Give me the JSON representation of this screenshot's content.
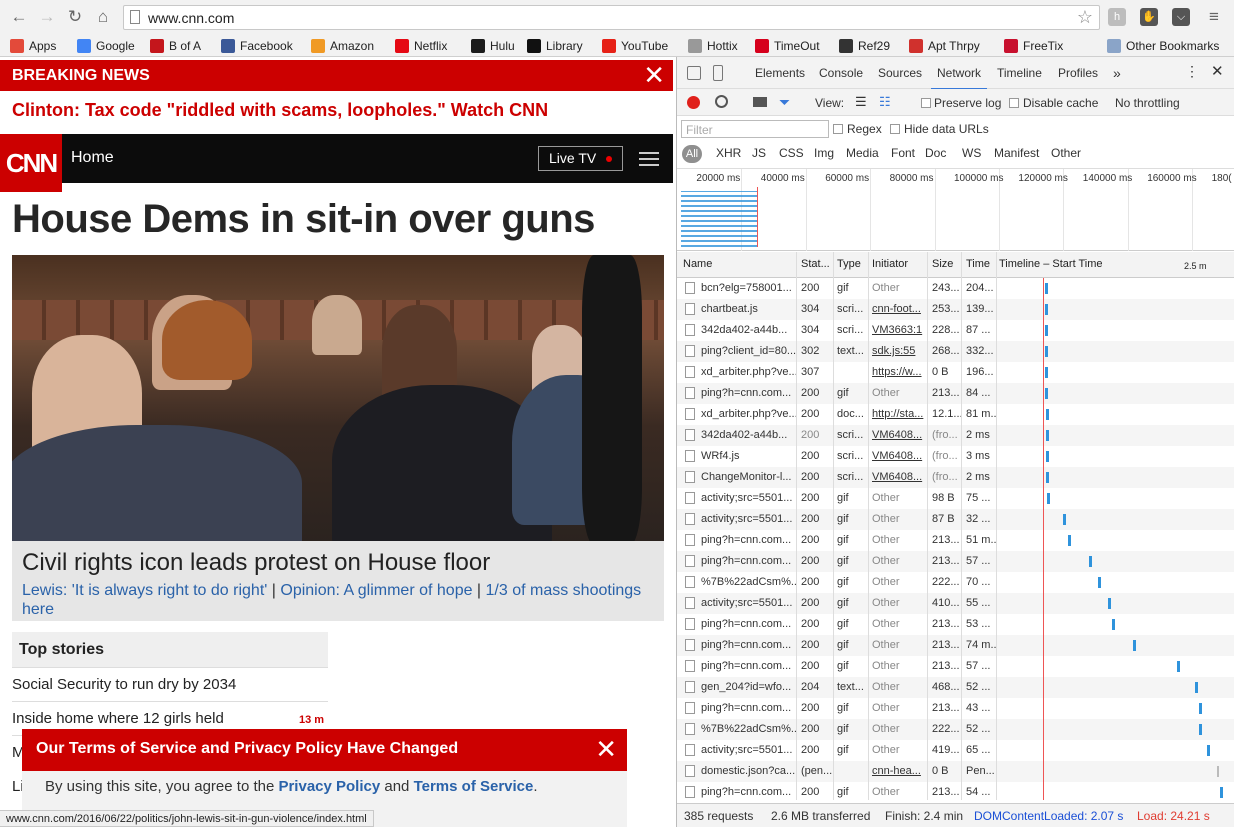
{
  "browser": {
    "url": "www.cnn.com",
    "status_url": "www.cnn.com/2016/06/22/politics/john-lewis-sit-in-gun-violence/index.html"
  },
  "bookmarks": [
    {
      "label": "Apps",
      "icon": "apps-grid-icon",
      "color": "#e34a3a"
    },
    {
      "label": "Google",
      "icon": "google-icon",
      "color": "#4285f4"
    },
    {
      "label": "B of A",
      "icon": "bofa-icon",
      "color": "#c4161c"
    },
    {
      "label": "Facebook",
      "icon": "facebook-icon",
      "color": "#3b5998"
    },
    {
      "label": "Amazon",
      "icon": "amazon-icon",
      "color": "#f09a25"
    },
    {
      "label": "Netflix",
      "icon": "netflix-icon",
      "color": "#e50914"
    },
    {
      "label": "Hulu",
      "icon": "hulu-icon",
      "color": "#1b1b1b"
    },
    {
      "label": "Library",
      "icon": "library-icon",
      "color": "#111111"
    },
    {
      "label": "YouTube",
      "icon": "youtube-icon",
      "color": "#e62117"
    },
    {
      "label": "Hottix",
      "icon": "page-icon",
      "color": "#999999"
    },
    {
      "label": "TimeOut",
      "icon": "timeout-icon",
      "color": "#d6001c"
    },
    {
      "label": "Ref29",
      "icon": "ref29-icon",
      "color": "#333333"
    },
    {
      "label": "Apt Thrpy",
      "icon": "apt-icon",
      "color": "#d0312d"
    },
    {
      "label": "FreeTix",
      "icon": "freetix-icon",
      "color": "#c8102e"
    },
    {
      "label": "Other Bookmarks",
      "icon": "folder-icon",
      "color": "#8aa4c8"
    }
  ],
  "cnn": {
    "breaking_label": "BREAKING NEWS",
    "breaking_link": "Clinton: Tax code \"riddled with scams, loopholes.\" Watch CNN",
    "logo": "CNN",
    "home": "Home",
    "live_tv": "Live TV",
    "headline": "House Dems in sit-in over guns",
    "caption_title": "Civil rights icon leads protest on House floor",
    "caption_links": [
      "Lewis: 'It is always right to do right'",
      "Opinion: A glimmer of hope",
      "1/3 of mass shootings here"
    ],
    "caption_sep": " | ",
    "top_stories_title": "Top stories",
    "stories": [
      "Social Security to run dry by 2034",
      "Inside home where 12 girls held",
      "M",
      "Li"
    ],
    "story_badge": "13 m",
    "terms_title": "Our Terms of Service and Privacy Policy Have Changed",
    "terms_text_1": "By using this site, you agree to the ",
    "terms_link_1": "Privacy Policy",
    "terms_text_2": " and ",
    "terms_link_2": "Terms of Service",
    "terms_text_3": "."
  },
  "devtools": {
    "tabs": [
      "Elements",
      "Console",
      "Sources",
      "Network",
      "Timeline",
      "Profiles"
    ],
    "more": "»",
    "view_label": "View:",
    "preserve_log": "Preserve log",
    "disable_cache": "Disable cache",
    "throttling": "No throttling",
    "filter_placeholder": "Filter",
    "regex": "Regex",
    "hide_data": "Hide data URLs",
    "type_filters": [
      "All",
      "XHR",
      "JS",
      "CSS",
      "Img",
      "Media",
      "Font",
      "Doc",
      "WS",
      "Manifest",
      "Other"
    ],
    "overview_ticks": [
      "20000 ms",
      "40000 ms",
      "60000 ms",
      "80000 ms",
      "100000 ms",
      "120000 ms",
      "140000 ms",
      "160000 ms",
      "180("
    ],
    "columns": [
      "Name",
      "Stat...",
      "Type",
      "Initiator",
      "Size",
      "Time",
      "Timeline – Start Time",
      "2.5 m"
    ],
    "rows": [
      [
        "bcn?elg=758001...",
        "200",
        "gif",
        "Other",
        "243...",
        "204..."
      ],
      [
        "chartbeat.js",
        "304",
        "scri...",
        "cnn-foot...",
        "253...",
        "139..."
      ],
      [
        "342da402-a44b...",
        "304",
        "scri...",
        "VM3663:1",
        "228...",
        "87 ..."
      ],
      [
        "ping?client_id=80...",
        "302",
        "text...",
        "sdk.js:55",
        "268...",
        "332..."
      ],
      [
        "xd_arbiter.php?ve...",
        "307",
        "",
        "https://w...",
        "0 B",
        "196..."
      ],
      [
        "ping?h=cnn.com...",
        "200",
        "gif",
        "Other",
        "213...",
        "84 ..."
      ],
      [
        "xd_arbiter.php?ve...",
        "200",
        "doc...",
        "http://sta...",
        "12.1...",
        "81 m..."
      ],
      [
        "342da402-a44b...",
        "200",
        "scri...",
        "VM6408...",
        "(fro...",
        "2 ms"
      ],
      [
        "WRf4.js",
        "200",
        "scri...",
        "VM6408...",
        "(fro...",
        "3 ms"
      ],
      [
        "ChangeMonitor-l...",
        "200",
        "scri...",
        "VM6408...",
        "(fro...",
        "2 ms"
      ],
      [
        "activity;src=5501...",
        "200",
        "gif",
        "Other",
        "98 B",
        "75 ..."
      ],
      [
        "activity;src=5501...",
        "200",
        "gif",
        "Other",
        "87 B",
        "32 ..."
      ],
      [
        "ping?h=cnn.com...",
        "200",
        "gif",
        "Other",
        "213...",
        "51 m..."
      ],
      [
        "ping?h=cnn.com...",
        "200",
        "gif",
        "Other",
        "213...",
        "57 ..."
      ],
      [
        "%7B%22adCsm%...",
        "200",
        "gif",
        "Other",
        "222...",
        "70 ..."
      ],
      [
        "activity;src=5501...",
        "200",
        "gif",
        "Other",
        "410...",
        "55 ..."
      ],
      [
        "ping?h=cnn.com...",
        "200",
        "gif",
        "Other",
        "213...",
        "53 ..."
      ],
      [
        "ping?h=cnn.com...",
        "200",
        "gif",
        "Other",
        "213...",
        "74 m..."
      ],
      [
        "ping?h=cnn.com...",
        "200",
        "gif",
        "Other",
        "213...",
        "57 ..."
      ],
      [
        "gen_204?id=wfo...",
        "204",
        "text...",
        "Other",
        "468...",
        "52 ..."
      ],
      [
        "ping?h=cnn.com...",
        "200",
        "gif",
        "Other",
        "213...",
        "43 ..."
      ],
      [
        "%7B%22adCsm%...",
        "200",
        "gif",
        "Other",
        "222...",
        "52 ..."
      ],
      [
        "activity;src=5501...",
        "200",
        "gif",
        "Other",
        "419...",
        "65 ..."
      ],
      [
        "domestic.json?ca...",
        "(pen...",
        "",
        "cnn-hea...",
        "0 B",
        "Pen..."
      ],
      [
        "ping?h=cnn.com...",
        "200",
        "gif",
        "Other",
        "213...",
        "54 ..."
      ]
    ],
    "status": {
      "requests": "385 requests",
      "transferred": "2.6 MB transferred",
      "finish": "Finish: 2.4 min",
      "dcl": "DOMContentLoaded: 2.07 s",
      "load": "Load: 24.21 s"
    },
    "colors": {
      "accent": "#3879d9",
      "waterfall": "#2f93dc",
      "load": "#e03c31",
      "dcl": "#1a4fd6",
      "record": "#e0201b"
    }
  }
}
